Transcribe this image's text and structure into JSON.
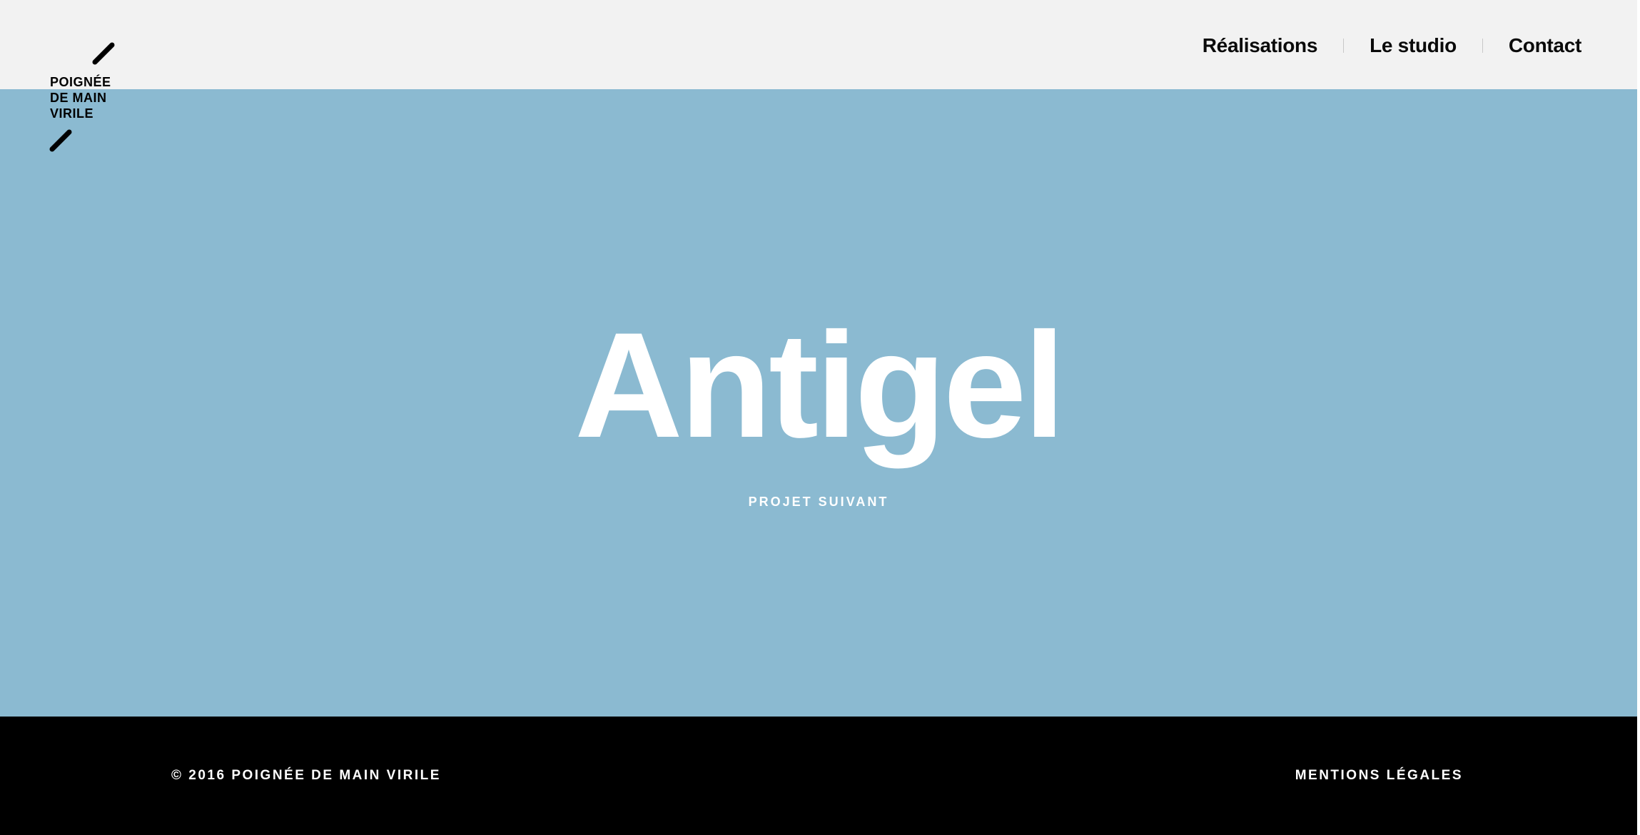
{
  "colors": {
    "header_bg": "#f2f2f2",
    "hero_bg": "#8bbad1",
    "footer_bg": "#000000",
    "text_dark": "#0a0a0a",
    "text_light": "#ffffff"
  },
  "logo": {
    "lines": [
      "POIGNÉE",
      "DE MAIN",
      "VIRILE"
    ],
    "icon": "slash-mark-icon"
  },
  "nav": {
    "items": [
      {
        "label": "Réalisations"
      },
      {
        "label": "Le studio"
      },
      {
        "label": "Contact"
      }
    ]
  },
  "hero": {
    "title": "Antigel",
    "link_label": "PROJET SUIVANT"
  },
  "footer": {
    "copyright": "© 2016 POIGNÉE DE MAIN VIRILE",
    "legal_label": "MENTIONS LÉGALES"
  }
}
